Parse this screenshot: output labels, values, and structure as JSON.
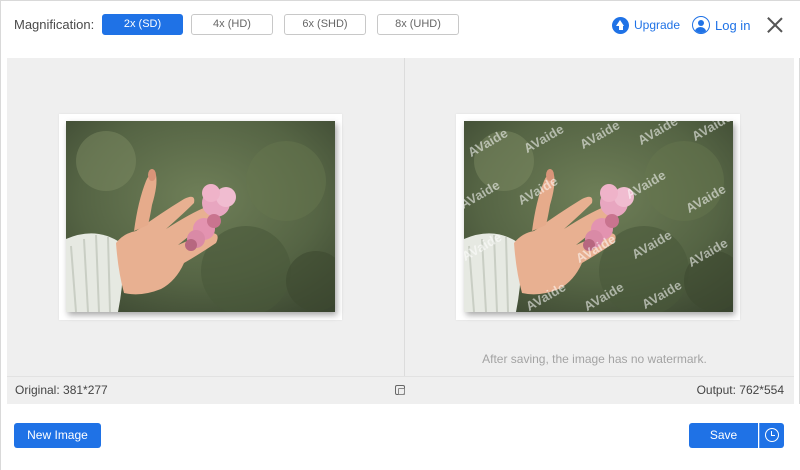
{
  "magnification": {
    "label": "Magnification:",
    "options": [
      {
        "label": "2x (SD)",
        "selected": true
      },
      {
        "label": "4x (HD)",
        "selected": false
      },
      {
        "label": "6x (SHD)",
        "selected": false
      },
      {
        "label": "8x (UHD)",
        "selected": false
      }
    ]
  },
  "header": {
    "upgrade_label": "Upgrade",
    "login_label": "Log in"
  },
  "preview": {
    "original_image": "hand-holding-pink-flowers-photo",
    "output_image": "hand-holding-pink-flowers-photo-watermarked",
    "watermark_text": "AVaide",
    "note": "After saving, the image has no watermark."
  },
  "status": {
    "original": "Original: 381*277",
    "output": "Output: 762*554"
  },
  "footer": {
    "new_image_label": "New Image",
    "save_label": "Save"
  },
  "colors": {
    "accent": "#1f72e6",
    "workspace_bg": "#efefef",
    "note_text": "#a3a3a3"
  }
}
